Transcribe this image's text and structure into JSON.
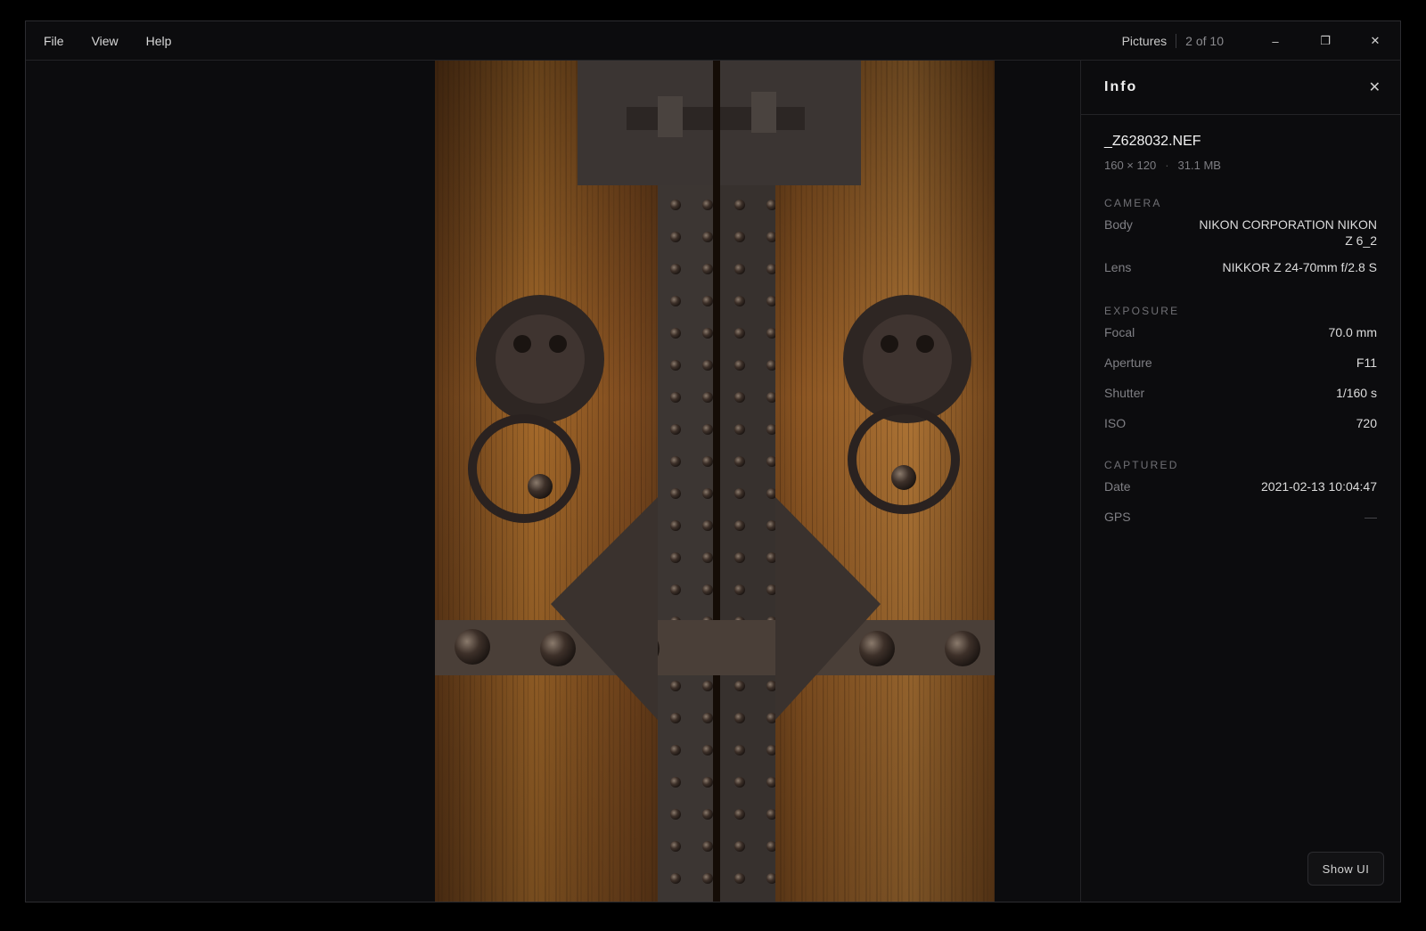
{
  "menu": {
    "items": [
      "File",
      "View",
      "Help"
    ]
  },
  "titlebar": {
    "app_name": "Pictures",
    "counter": "2 of 10"
  },
  "window_controls": {
    "minimize": "–",
    "maximize": "❐",
    "close": "✕"
  },
  "info": {
    "title": "Info",
    "close_glyph": "✕",
    "filename": "_Z628032.NEF",
    "dimensions": "160 × 120",
    "separator": "·",
    "filesize": "31.1 MB",
    "camera": {
      "title": "CAMERA",
      "body_label": "Body",
      "body_value": "NIKON CORPORATION NIKON Z 6_2",
      "lens_label": "Lens",
      "lens_value": "NIKKOR Z 24-70mm f/2.8 S"
    },
    "exposure": {
      "title": "EXPOSURE",
      "focal_label": "Focal",
      "focal_value": "70.0 mm",
      "aperture_label": "Aperture",
      "aperture_value": "F11",
      "shutter_label": "Shutter",
      "shutter_value": "1/160 s",
      "iso_label": "ISO",
      "iso_value": "720"
    },
    "captured": {
      "title": "CAPTURED",
      "date_label": "Date",
      "date_value": "2021-02-13 10:04:47",
      "gps_label": "GPS",
      "gps_value": "—"
    },
    "show_ui_label": "Show UI"
  },
  "colors": {
    "background": "#0c0c0e",
    "border": "#232327",
    "wood": "#a8672a",
    "iron": "#3a3532"
  }
}
